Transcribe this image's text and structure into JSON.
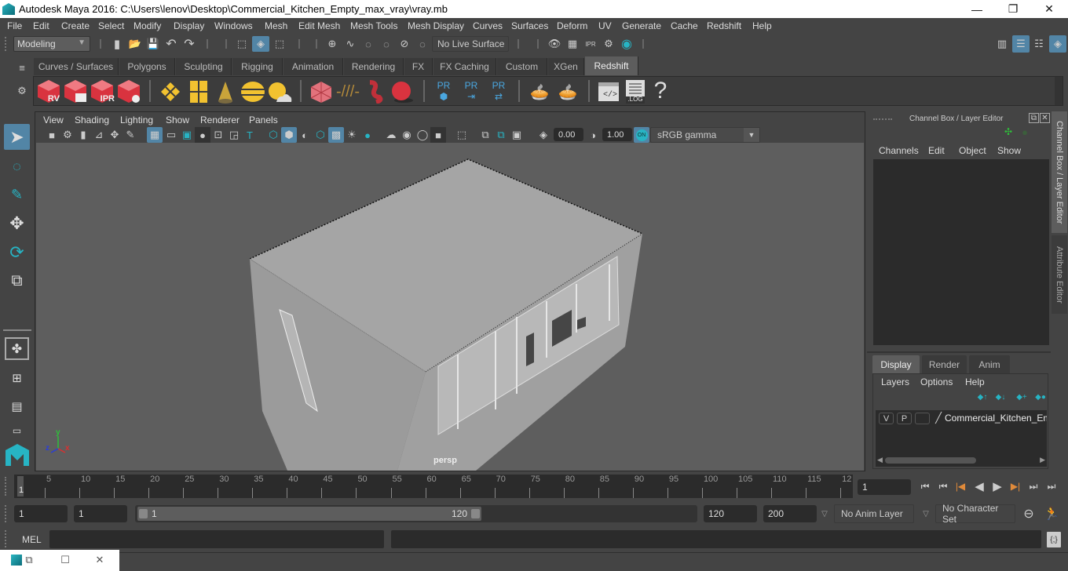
{
  "window": {
    "title": "Autodesk Maya 2016: C:\\Users\\lenov\\Desktop\\Commercial_Kitchen_Empty_max_vray\\vray.mb",
    "controls": {
      "minimize": "—",
      "maximize": "❐",
      "close": "✕"
    }
  },
  "menubar": [
    "File",
    "Edit",
    "Create",
    "Select",
    "Modify",
    "Display",
    "Windows",
    "Mesh",
    "Edit Mesh",
    "Mesh Tools",
    "Mesh Display",
    "Curves",
    "Surfaces",
    "Deform",
    "UV",
    "Generate",
    "Cache",
    "Redshift",
    "Help"
  ],
  "statusline": {
    "mode": "Modeling",
    "live_surface": "No Live Surface"
  },
  "shelf": {
    "tabs": [
      "Curves / Surfaces",
      "Polygons",
      "Sculpting",
      "Rigging",
      "Animation",
      "Rendering",
      "FX",
      "FX Caching",
      "Custom",
      "XGen",
      "Redshift"
    ],
    "active_tab": "Redshift",
    "icons": {
      "rv": "RV",
      "ipr": "IPR",
      "pr": "PR",
      "log": ".LOG",
      "help": "?"
    }
  },
  "viewport": {
    "menu": [
      "View",
      "Shading",
      "Lighting",
      "Show",
      "Renderer",
      "Panels"
    ],
    "exposure": "0.00",
    "gamma": "1.00",
    "color_mgmt_toggle": "ON",
    "color_space": "sRGB gamma",
    "camera_label": "persp",
    "axis": {
      "x": "x",
      "y": "y",
      "z": "z"
    }
  },
  "channel_box": {
    "title": "Channel Box / Layer Editor",
    "menu": [
      "Channels",
      "Edit",
      "Object",
      "Show"
    ],
    "layer_tabs": [
      "Display",
      "Render",
      "Anim"
    ],
    "active_layer_tab": "Display",
    "layer_menu": [
      "Layers",
      "Options",
      "Help"
    ],
    "layers": [
      {
        "visible": "V",
        "playback": "P",
        "name": "Commercial_Kitchen_Emp"
      }
    ]
  },
  "side_tabs": [
    "Channel Box / Layer Editor",
    "Attribute Editor"
  ],
  "timeline": {
    "start_label": "1",
    "ticks": [
      "5",
      "10",
      "15",
      "20",
      "25",
      "30",
      "35",
      "40",
      "45",
      "50",
      "55",
      "60",
      "65",
      "70",
      "75",
      "80",
      "85",
      "90",
      "95",
      "100",
      "105",
      "110",
      "115",
      "12"
    ],
    "current_frame": "1"
  },
  "range": {
    "start": "1",
    "playback_start": "1",
    "slider_start": "1",
    "slider_end": "120",
    "playback_end": "120",
    "end": "200",
    "anim_layer": "No Anim Layer",
    "character_set": "No Character Set"
  },
  "command_line": {
    "language": "MEL",
    "input": "",
    "result": ""
  },
  "colors": {
    "accent_blue": "#5285a6",
    "teal": "#27b4c4",
    "playback_orange": "#e08a3a",
    "redshift_red": "#d9333f",
    "viewport_bg": "#5e5e5e",
    "model_gray": "#9e9e9e"
  }
}
